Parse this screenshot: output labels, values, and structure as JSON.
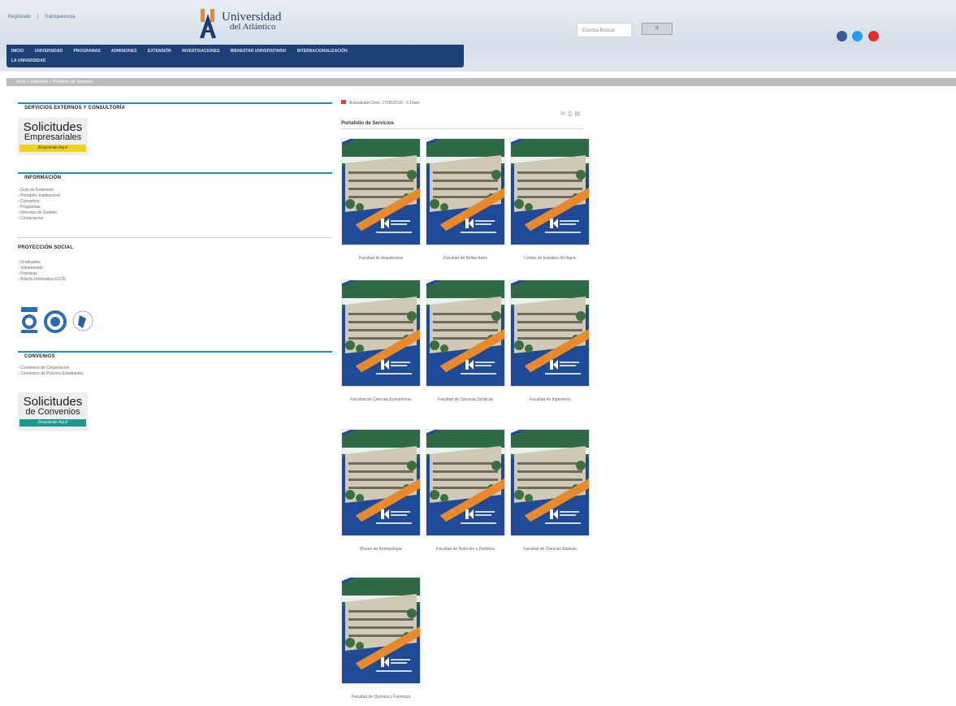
{
  "header": {
    "top_links": [
      "Regístrate",
      "Transparencia"
    ],
    "logo_text_line1": "Universidad",
    "logo_text_line2": "del Atlántico",
    "search_placeholder": "Escriba Buscar",
    "search_button": "Ir"
  },
  "nav": {
    "row1": [
      "INICIO",
      "UNIVERSIDAD",
      "PROGRAMAS",
      "ADMISIONES",
      "EXTENSIÓN",
      "INVESTIGACIONES",
      "BIENESTAR UNIVERSITARIO",
      "INTERNACIONALIZACIÓN"
    ],
    "row2": [
      "LA UNIVERSIDAD"
    ]
  },
  "breadcrumb": "Inicio > Extensión > Portafolio de Servicios",
  "sidebar": {
    "sec1_title": "SERVICIOS EXTERNOS Y CONSULTORÍA",
    "promo1": {
      "line1": "Solicitudes",
      "line2": "Empresariales",
      "strip": "¡Regístrate Aquí!"
    },
    "sec2_title": "INFORMACIÓN",
    "info_links": [
      "Guía de Extensión",
      "Portafolio Institucional",
      "Convenios",
      "Programas",
      "Informes de Gestión",
      "Contáctenos"
    ],
    "sec3_title": "PROYECCIÓN SOCIAL",
    "social_links": [
      "Graduados",
      "Voluntariado",
      "Practicas",
      "Boletín Informativo EXTE"
    ],
    "sec4_title": "CONVENIOS",
    "convenio_links": [
      "Convenios de Cooperación",
      "Convenios de Práctica Estudiantes"
    ],
    "promo2": {
      "line1": "Solicitudes",
      "line2": "de Convenios",
      "strip": "¡Regístrate Aquí!"
    }
  },
  "main": {
    "updated": "Actualizado Dom, 17/06/2018 - 6:19am",
    "title": "Portafolio de Servicios",
    "cards": [
      "Facultad de Arquitectura",
      "Facultad de Bellas Artes",
      "Centro de Estudios del Agua",
      "Facultad de Ciencias Económicas",
      "Facultad de Ciencias Jurídicas",
      "Facultad de Ingeniería",
      "Museo de Antropología",
      "Facultad de Nutrición y Dietética",
      "Facultad de Ciencias Básicas",
      "Facultad de Química y Farmacia"
    ]
  },
  "colors": {
    "nav_bg": "#1c3f78",
    "accent_line": "#1d90b8",
    "card_blue": "#1f4a97",
    "card_orange": "#e8892c"
  }
}
